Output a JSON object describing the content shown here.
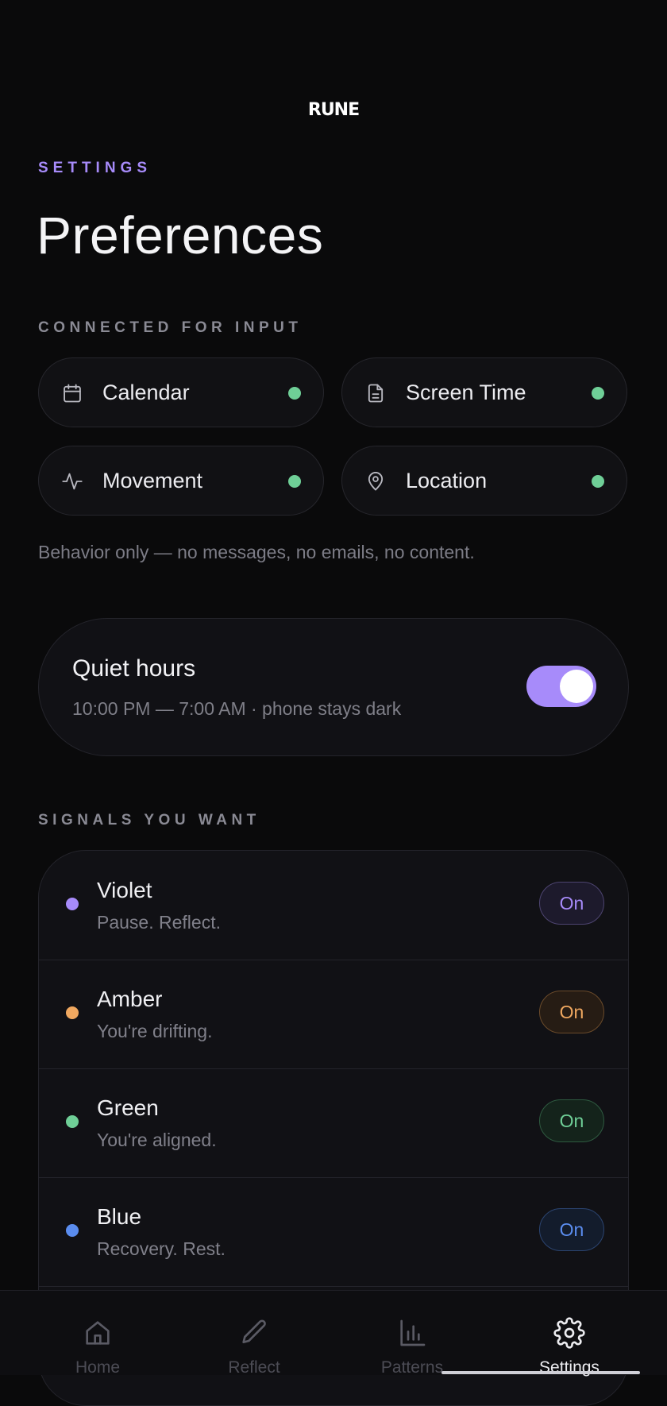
{
  "app": {
    "logo": "RUNE"
  },
  "header": {
    "eyebrow": "SETTINGS",
    "title": "Preferences"
  },
  "connected": {
    "label": "CONNECTED FOR INPUT",
    "sources": [
      {
        "label": "Calendar",
        "icon": "calendar-icon",
        "status": "connected"
      },
      {
        "label": "Screen Time",
        "icon": "document-icon",
        "status": "connected"
      },
      {
        "label": "Movement",
        "icon": "activity-icon",
        "status": "connected"
      },
      {
        "label": "Location",
        "icon": "map-pin-icon",
        "status": "connected"
      }
    ],
    "note": "Behavior only — no messages, no emails, no content."
  },
  "quiet_hours": {
    "title": "Quiet hours",
    "subtitle": "10:00 PM — 7:00 AM · phone stays dark",
    "enabled": true
  },
  "signals": {
    "label": "SIGNALS YOU WANT",
    "items": [
      {
        "name": "Violet",
        "description": "Pause. Reflect.",
        "state": "On",
        "color": "#a78bfa"
      },
      {
        "name": "Amber",
        "description": "You're drifting.",
        "state": "On",
        "color": "#f0a860"
      },
      {
        "name": "Green",
        "description": "You're aligned.",
        "state": "On",
        "color": "#6fcf97"
      },
      {
        "name": "Blue",
        "description": "Recovery. Rest.",
        "state": "On",
        "color": "#5b8def"
      }
    ]
  },
  "tabbar": {
    "tabs": [
      {
        "label": "Home",
        "icon": "home-icon",
        "active": false
      },
      {
        "label": "Reflect",
        "icon": "pencil-icon",
        "active": false
      },
      {
        "label": "Patterns",
        "icon": "bar-chart-icon",
        "active": false
      },
      {
        "label": "Settings",
        "icon": "gear-icon",
        "active": true
      }
    ]
  },
  "colors": {
    "accent": "#a78bfa",
    "connected": "#6fcf97",
    "background": "#0a0a0b"
  }
}
